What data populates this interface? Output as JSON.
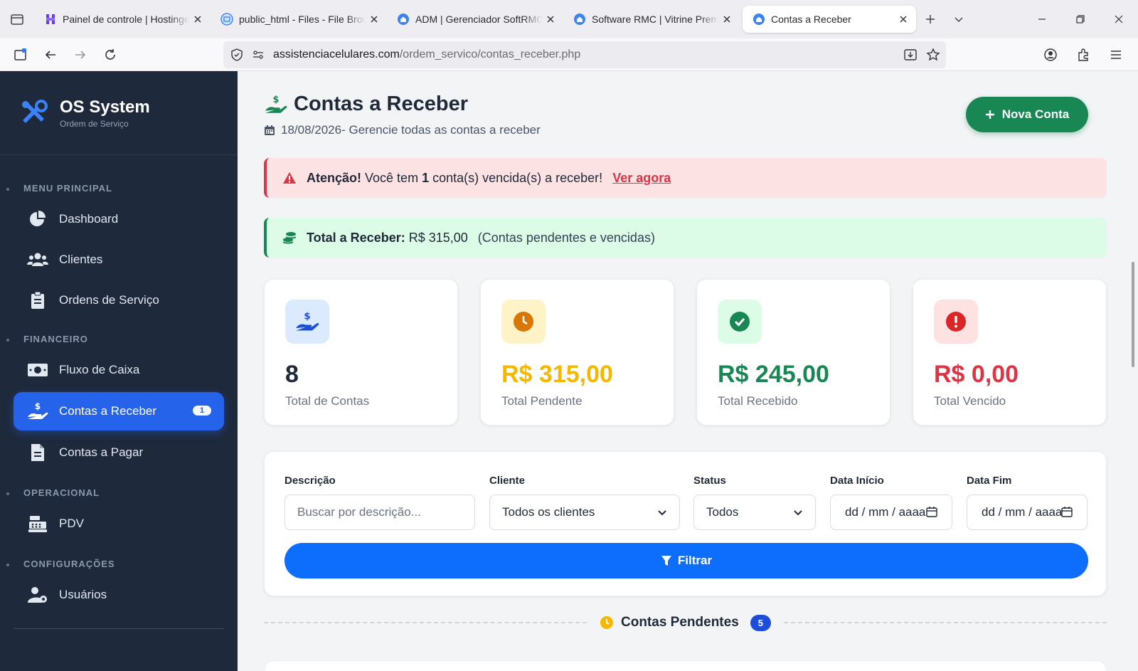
{
  "browser": {
    "tabs": [
      {
        "title": "Painel de controle | Hostinger",
        "active": false
      },
      {
        "title": "public_html - Files - File Browser",
        "active": false
      },
      {
        "title": "ADM | Gerenciador SoftRMC",
        "active": false
      },
      {
        "title": "Software RMC | Vitrine Premium",
        "active": false
      },
      {
        "title": "Contas a Receber",
        "active": true
      }
    ],
    "url_host": "assistenciacelulares.com",
    "url_path": "/ordem_servico/contas_receber.php"
  },
  "sidebar": {
    "brand_title": "OS System",
    "brand_sub": "Ordem de Serviço",
    "sections": {
      "main": "MENU PRINCIPAL",
      "finance": "FINANCEIRO",
      "operational": "OPERACIONAL",
      "config": "CONFIGURAÇÕES"
    },
    "items": {
      "dashboard": "Dashboard",
      "clients": "Clientes",
      "orders": "Ordens de Serviço",
      "cashflow": "Fluxo de Caixa",
      "receivables": "Contas a Receber",
      "receivables_badge": "1",
      "payables": "Contas a Pagar",
      "pdv": "PDV",
      "users": "Usuários"
    }
  },
  "header": {
    "title": "Contas a Receber",
    "date": "18/08/2026",
    "subtitle": " - Gerencie todas as contas a receber",
    "new_button": "Nova Conta"
  },
  "alerts": {
    "danger_strong": "Atenção!",
    "danger_text_1": " Você tem ",
    "danger_count": "1",
    "danger_text_2": " conta(s) vencida(s) a receber!",
    "danger_link": "Ver agora",
    "total_label": "Total a Receber:",
    "total_value": " R$ 315,00",
    "total_note": "(Contas pendentes e vencidas)"
  },
  "cards": [
    {
      "value": "8",
      "label": "Total de Contas",
      "color": "#1f2937"
    },
    {
      "value": "R$ 315,00",
      "label": "Total Pendente",
      "color": "#f5b800"
    },
    {
      "value": "R$ 245,00",
      "label": "Total Recebido",
      "color": "#198754"
    },
    {
      "value": "R$ 0,00",
      "label": "Total Vencido",
      "color": "#dc3545"
    }
  ],
  "filters": {
    "desc_label": "Descrição",
    "desc_placeholder": "Buscar por descrição...",
    "client_label": "Cliente",
    "client_value": "Todos os clientes",
    "status_label": "Status",
    "status_value": "Todos",
    "start_label": "Data Início",
    "start_value": "dd / mm / aaaa",
    "end_label": "Data Fim",
    "end_value": "dd / mm / aaaa",
    "filter_button": "Filtrar"
  },
  "pending": {
    "title": "Contas Pendentes",
    "count": "5"
  },
  "colors": {
    "primary": "#0d6efd",
    "success": "#198754",
    "danger": "#dc3545",
    "warning": "#f5b800",
    "sidebar": "#1e293b"
  }
}
